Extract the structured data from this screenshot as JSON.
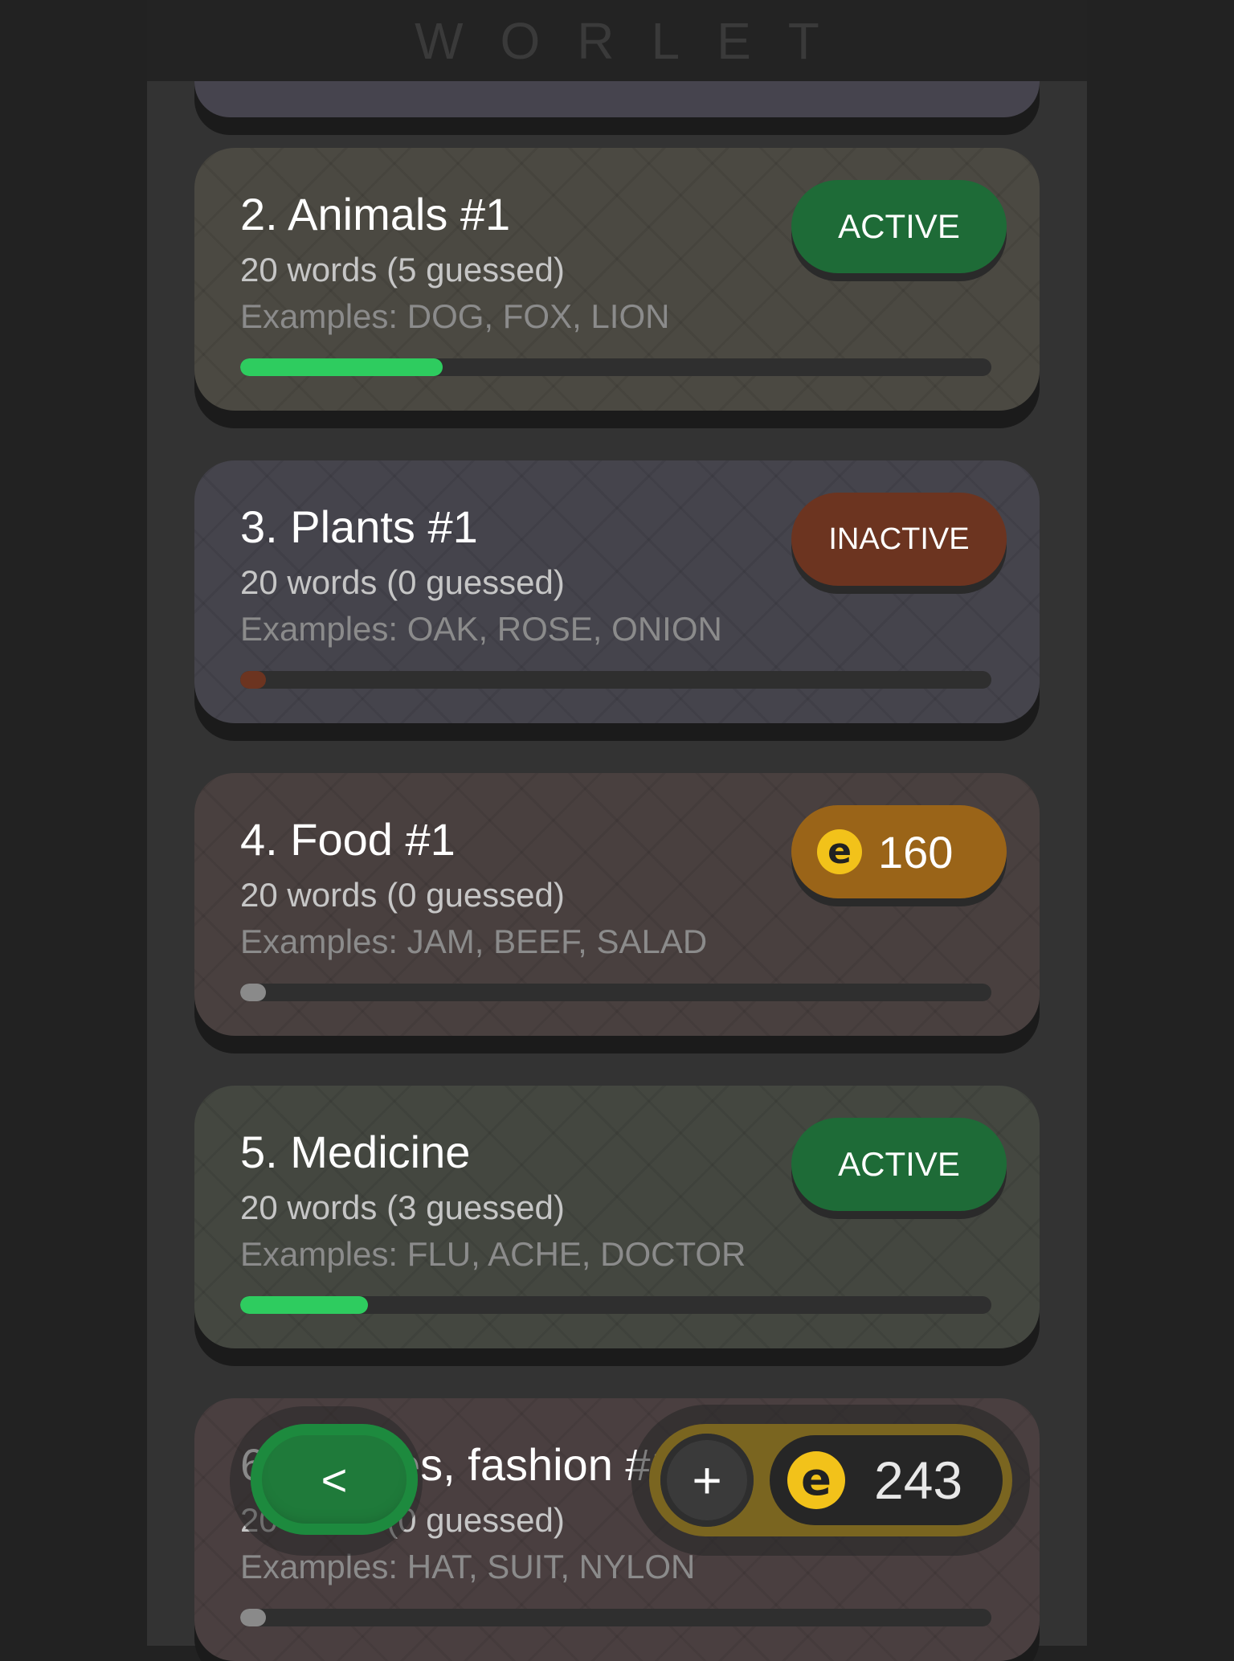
{
  "app": {
    "logo": "WORLET"
  },
  "categories": [
    {
      "title": "2. Animals #1",
      "words": "20 words (5 guessed)",
      "examples": "Examples: DOG, FOX, LION",
      "status": "ACTIVE",
      "progress": 0.27,
      "progress_color": "#2ecc5f"
    },
    {
      "title": "3. Plants #1",
      "words": "20 words (0 guessed)",
      "examples": "Examples: OAK, ROSE, ONION",
      "status": "INACTIVE",
      "progress": 0.0,
      "progress_color": "#6c3420"
    },
    {
      "title": "4. Food #1",
      "words": "20 words (0 guessed)",
      "examples": "Examples: JAM, BEEF, SALAD",
      "price": "160",
      "progress": 0.0,
      "progress_color": "#8a8a8a"
    },
    {
      "title": "5. Medicine",
      "words": "20 words (3 guessed)",
      "examples": "Examples: FLU, ACHE, DOCTOR",
      "status": "ACTIVE",
      "progress": 0.17,
      "progress_color": "#2ecc5f"
    },
    {
      "title": "6. Clothes, fashion #1",
      "words": "20 words (0 guessed)",
      "examples": "Examples: HAT, SUIT, NYLON",
      "progress": 0.0,
      "progress_color": "#8a8a8a"
    }
  ],
  "controls": {
    "back_label": "<",
    "add_label": "+",
    "balance": "243"
  },
  "icons": {
    "coin": "coin-icon",
    "back": "back-icon",
    "add": "plus-icon"
  },
  "colors": {
    "active": "#1e6b37",
    "inactive": "#6c3420",
    "price": "#9a6418",
    "progress_active": "#2ecc5f"
  }
}
